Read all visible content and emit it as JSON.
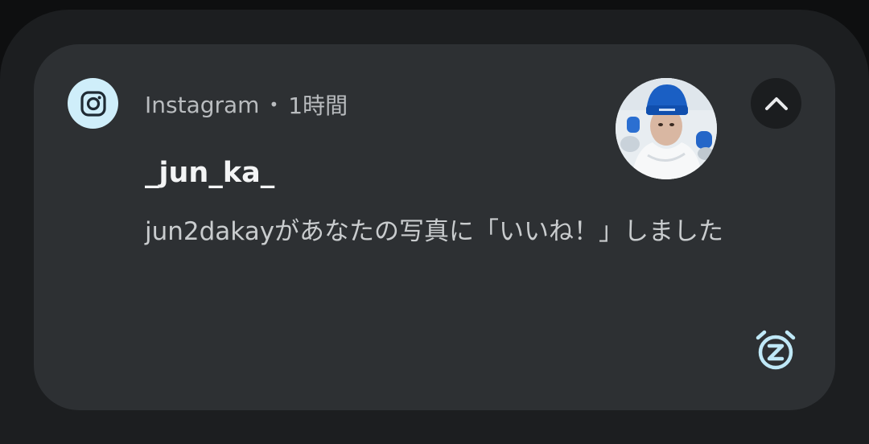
{
  "notification": {
    "app_name": "Instagram",
    "separator": "•",
    "time": "1時間",
    "title": "_jun_ka_",
    "message": "jun2dakayがあなたの写真に「いいね！」しました",
    "app_icon": "instagram-icon",
    "expand_icon": "chevron-up-icon",
    "snooze_icon": "snooze-alarm-icon",
    "avatar": "profile-photo"
  },
  "colors": {
    "card_bg": "#2d3033",
    "shade_bg": "#1c1e20",
    "icon_accent": "#cfeefa",
    "title_text": "#f3f4f5",
    "body_text": "#c9ccce"
  }
}
